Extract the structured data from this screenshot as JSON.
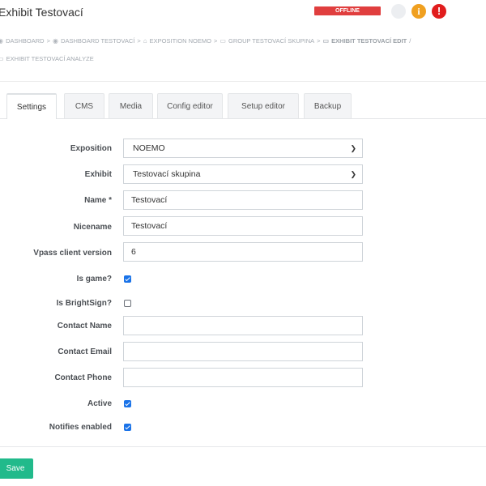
{
  "header": {
    "title": "Exhibit Testovací",
    "status_badge": "OFFLINE",
    "info_icon_glyph": "i",
    "alert_icon_glyph": "!",
    "colors": {
      "offline": "#e03e3e",
      "info": "#f0a020",
      "alert": "#e11d1d"
    }
  },
  "breadcrumb": {
    "items": [
      {
        "icon": "dashboard-icon",
        "label": "DASHBOARD"
      },
      {
        "icon": "dashboard-icon",
        "label": "DASHBOARD TESTOVACÍ"
      },
      {
        "icon": "museum-icon",
        "label": "EXPOSITION NOEMO"
      },
      {
        "icon": "monitor-icon",
        "label": "GROUP TESTOVACÍ SKUPINA"
      },
      {
        "icon": "monitor-icon",
        "label": "EXHIBIT TESTOVACÍ EDIT"
      },
      {
        "icon": "monitor-icon",
        "label": "EXHIBIT TESTOVACÍ ANALYZE"
      }
    ],
    "separator": ">",
    "trailing_separator": "/"
  },
  "tabs": [
    {
      "label": "Settings",
      "active": true
    },
    {
      "label": "CMS"
    },
    {
      "label": "Media"
    },
    {
      "label": "Config editor"
    },
    {
      "label": "Setup editor"
    },
    {
      "label": "Backup"
    }
  ],
  "form": {
    "exposition": {
      "label": "Exposition",
      "value": "NOEMO"
    },
    "exhibit": {
      "label": "Exhibit",
      "value": "Testovací skupina"
    },
    "name": {
      "label": "Name *",
      "value": "Testovací"
    },
    "nicename": {
      "label": "Nicename",
      "value": "Testovací"
    },
    "vpass_client_version": {
      "label": "Vpass client version",
      "value": "6"
    },
    "is_game": {
      "label": "Is game?",
      "checked": true
    },
    "is_brightsign": {
      "label": "Is BrightSign?",
      "checked": false
    },
    "contact_name": {
      "label": "Contact Name",
      "value": ""
    },
    "contact_email": {
      "label": "Contact Email",
      "value": ""
    },
    "contact_phone": {
      "label": "Contact Phone",
      "value": ""
    },
    "active": {
      "label": "Active",
      "checked": true
    },
    "notifies_enabled": {
      "label": "Notifies enabled",
      "checked": true
    }
  },
  "actions": {
    "save_label": "Save",
    "save_color": "#21ba8b"
  }
}
